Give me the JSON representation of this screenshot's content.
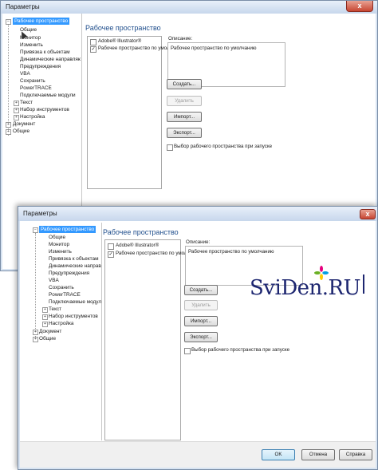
{
  "window": {
    "title": "Параметры",
    "close_glyph": "x"
  },
  "tree": {
    "selected": "Рабочее пространство",
    "children": [
      "Общие",
      "Монитор",
      "Изменить",
      "Привязка к объектам",
      "Динамические направляющие",
      "Предупреждения",
      "VBA",
      "Сохранить",
      "PowerTRACE",
      "Подключаемые модули"
    ],
    "expandable": [
      "Текст",
      "Набор инструментов",
      "Настройка"
    ],
    "top_level": [
      "Документ",
      "Общие"
    ]
  },
  "panel": {
    "title": "Рабочее пространство",
    "workspaces": [
      {
        "label": "Adobe® Illustrator®",
        "checked": false
      },
      {
        "label": "Рабочее пространство по умолчанию",
        "checked": true
      }
    ],
    "description_label": "Описание:",
    "description_text": "Рабочее пространство по умолчанию",
    "buttons": {
      "create": "Создать...",
      "delete": "Удалить",
      "import": "Импорт...",
      "export": "Экспорт..."
    },
    "startup_checkbox": "Выбор рабочего пространства при запуске"
  },
  "footer": {
    "ok": "OK",
    "cancel": "Отмена",
    "help": "Справка"
  },
  "watermark": {
    "text": "SviDen.RU",
    "colors": [
      "#e6007e",
      "#009fe3",
      "#ffcc00",
      "#6ab023"
    ]
  }
}
